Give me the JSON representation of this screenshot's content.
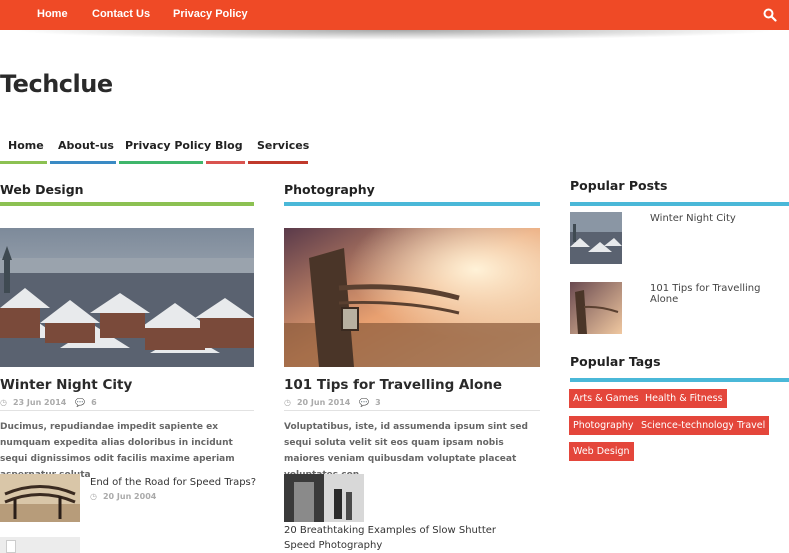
{
  "top_nav": {
    "items": [
      "Home",
      "Contact Us",
      "Privacy Policy"
    ]
  },
  "site": {
    "title": "Techclue"
  },
  "main_nav": {
    "items": [
      {
        "label": "Home",
        "color": "#8cc152"
      },
      {
        "label": "About-us",
        "color": "#3a8ac4"
      },
      {
        "label": "Privacy Policy",
        "color": "#3fb66b"
      },
      {
        "label": "Blog",
        "color": "#d9534f"
      },
      {
        "label": "Services",
        "color": "#c0392b"
      }
    ]
  },
  "web_design": {
    "heading": "Web Design",
    "accent": "#8cc152",
    "featured": {
      "title": "Winter Night City",
      "date": "23 Jun 2014",
      "comments": "6",
      "excerpt": "Ducimus, repudiandae impedit sapiente ex numquam expedita alias doloribus in incidunt sequi dignissimos odit facilis maxime aperiam aspernatur soluta"
    },
    "small": {
      "title": "End of the Road for Speed Traps?",
      "date": "20 Jun 2004"
    }
  },
  "photography": {
    "heading": "Photography",
    "accent": "#4ab8d8",
    "featured": {
      "title": "101 Tips for Travelling Alone",
      "date": "20 Jun 2014",
      "comments": "3",
      "excerpt": "Voluptatibus, iste, id assumenda ipsum sint sed sequi soluta velit sit eos quam ipsam nobis maiores veniam quibusdam voluptate placeat voluptates con"
    },
    "small": {
      "title": "20 Breathtaking Examples of Slow Shutter Speed Photography"
    }
  },
  "popular_posts": {
    "heading": "Popular Posts",
    "accent": "#4ab8d8",
    "items": [
      "Winter Night City",
      "101 Tips for Travelling Alone"
    ]
  },
  "popular_tags": {
    "heading": "Popular Tags",
    "accent": "#4ab8d8",
    "tags": [
      "Arts & Games",
      "Health & Fitness",
      "Photography",
      "Science-technology",
      "Travel",
      "Web Design"
    ]
  }
}
